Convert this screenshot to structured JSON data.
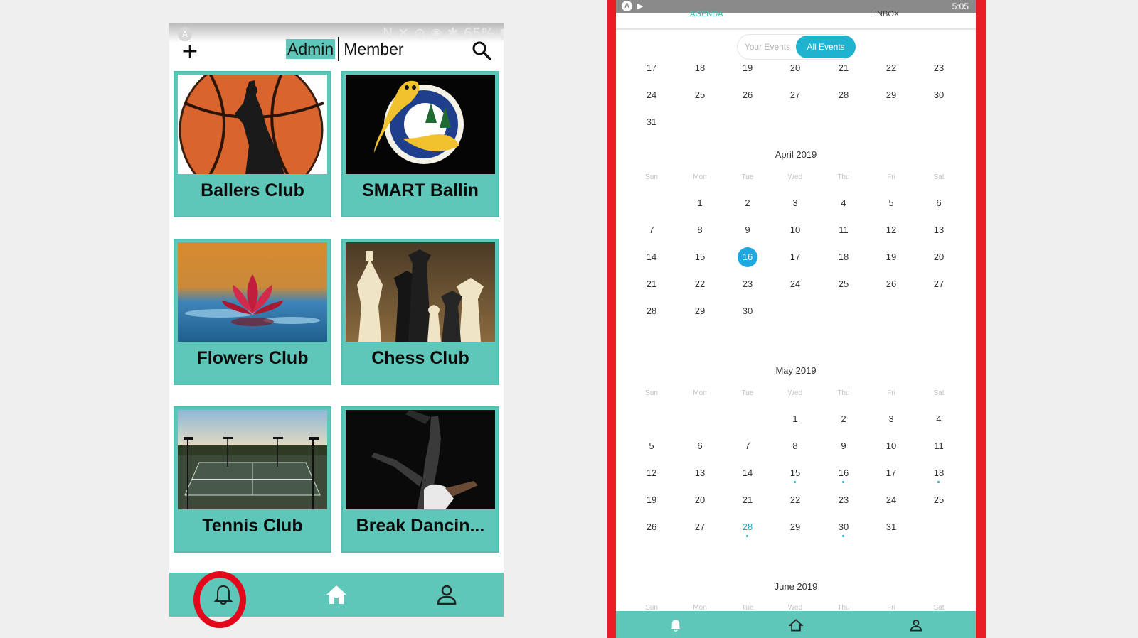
{
  "left_app": {
    "status_bar": {
      "text": "N ✕ ⊙ ◉ ✱ 65% ▮ 11:29 AM"
    },
    "header": {
      "plus_label": "+",
      "role_admin": "Admin",
      "role_member": "Member"
    },
    "clubs": [
      {
        "name": "Ballers Club"
      },
      {
        "name": "SMART Ballin"
      },
      {
        "name": "Flowers Club"
      },
      {
        "name": "Chess Club"
      },
      {
        "name": "Tennis Club"
      },
      {
        "name": "Break Dancin..."
      }
    ],
    "nav": {
      "items": [
        "bell-icon",
        "home-icon",
        "person-icon"
      ]
    },
    "highlight_color": "#e3071c",
    "accent_color": "#5ec7b9"
  },
  "right_app": {
    "status_bar": {
      "time": "5:05"
    },
    "tabs": {
      "agenda": "AGENDA",
      "inbox": "INBOX"
    },
    "toggle": {
      "your_events": "Your Events",
      "all_events": "All Events"
    },
    "frame_color": "#ec1c24",
    "weekdays": [
      "Sun",
      "Mon",
      "Tue",
      "Wed",
      "Thu",
      "Fri",
      "Sat"
    ],
    "march_tail": [
      [
        "17",
        "18",
        "19",
        "20",
        "21",
        "22",
        "23"
      ],
      [
        "24",
        "25",
        "26",
        "27",
        "28",
        "29",
        "30"
      ],
      [
        "31",
        "",
        "",
        "",
        "",
        "",
        ""
      ]
    ],
    "april": {
      "title": "April 2019",
      "weeks": [
        [
          "",
          "1",
          "2",
          "3",
          "4",
          "5",
          "6"
        ],
        [
          "7",
          "8",
          "9",
          "10",
          "11",
          "12",
          "13"
        ],
        [
          "14",
          "15",
          "16",
          "17",
          "18",
          "19",
          "20"
        ],
        [
          "21",
          "22",
          "23",
          "24",
          "25",
          "26",
          "27"
        ],
        [
          "28",
          "29",
          "30",
          "",
          "",
          "",
          ""
        ]
      ],
      "today": "16"
    },
    "may": {
      "title": "May 2019",
      "weeks": [
        [
          "",
          "",
          "",
          "1",
          "2",
          "3",
          "4"
        ],
        [
          "5",
          "6",
          "7",
          "8",
          "9",
          "10",
          "11"
        ],
        [
          "12",
          "13",
          "14",
          "15",
          "16",
          "17",
          "18"
        ],
        [
          "19",
          "20",
          "21",
          "22",
          "23",
          "24",
          "25"
        ],
        [
          "26",
          "27",
          "28",
          "29",
          "30",
          "31",
          ""
        ]
      ],
      "event_days": [
        "15",
        "16",
        "18",
        "28",
        "30"
      ],
      "highlight_days": [
        "28"
      ]
    },
    "june": {
      "title": "June 2019"
    },
    "nav": {
      "items": [
        "bell-icon",
        "home-icon",
        "person-icon"
      ]
    }
  }
}
